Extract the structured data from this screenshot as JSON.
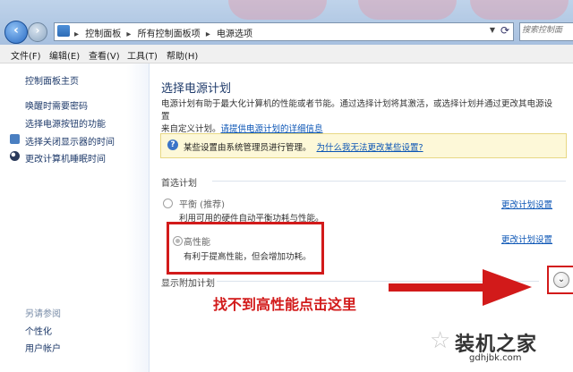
{
  "address_bar": {
    "crumbs": [
      "控制面板",
      "所有控制面板项",
      "电源选项"
    ],
    "search_placeholder": "搜索控制面"
  },
  "menu": [
    "文件(F)",
    "编辑(E)",
    "查看(V)",
    "工具(T)",
    "帮助(H)"
  ],
  "sidebar": {
    "home": "控制面板主页",
    "items": [
      "唤醒时需要密码",
      "选择电源按钮的功能",
      "选择关闭显示器的时间",
      "更改计算机睡眠时间"
    ],
    "see_also_heading": "另请参阅",
    "see_also": [
      "个性化",
      "用户帐户"
    ]
  },
  "main": {
    "title": "选择电源计划",
    "desc_line1": "电源计划有助于最大化计算机的性能或者节能。通过选择计划将其激活，或选择计划并通过更改其电源设置",
    "desc_line2_prefix": "来自定义计划。",
    "desc_link": "请提供电源计划的详细信息",
    "info_text": "某些设置由系统管理员进行管理。",
    "info_link": "为什么我无法更改某些设置?",
    "preferred_heading": "首选计划",
    "plans": [
      {
        "name": "平衡 (推荐)",
        "desc": "利用可用的硬件自动平衡功耗与性能。",
        "link": "更改计划设置"
      },
      {
        "name": "高性能",
        "desc": "有利于提高性能，但会增加功耗。",
        "link": "更改计划设置"
      }
    ],
    "additional_heading": "显示附加计划"
  },
  "annotation": "找不到高性能点击这里",
  "watermark": {
    "name": "装机之家",
    "url": "gdhjbk.com"
  },
  "colors": {
    "highlight": "#d21a1a",
    "link": "#0b55b5"
  }
}
